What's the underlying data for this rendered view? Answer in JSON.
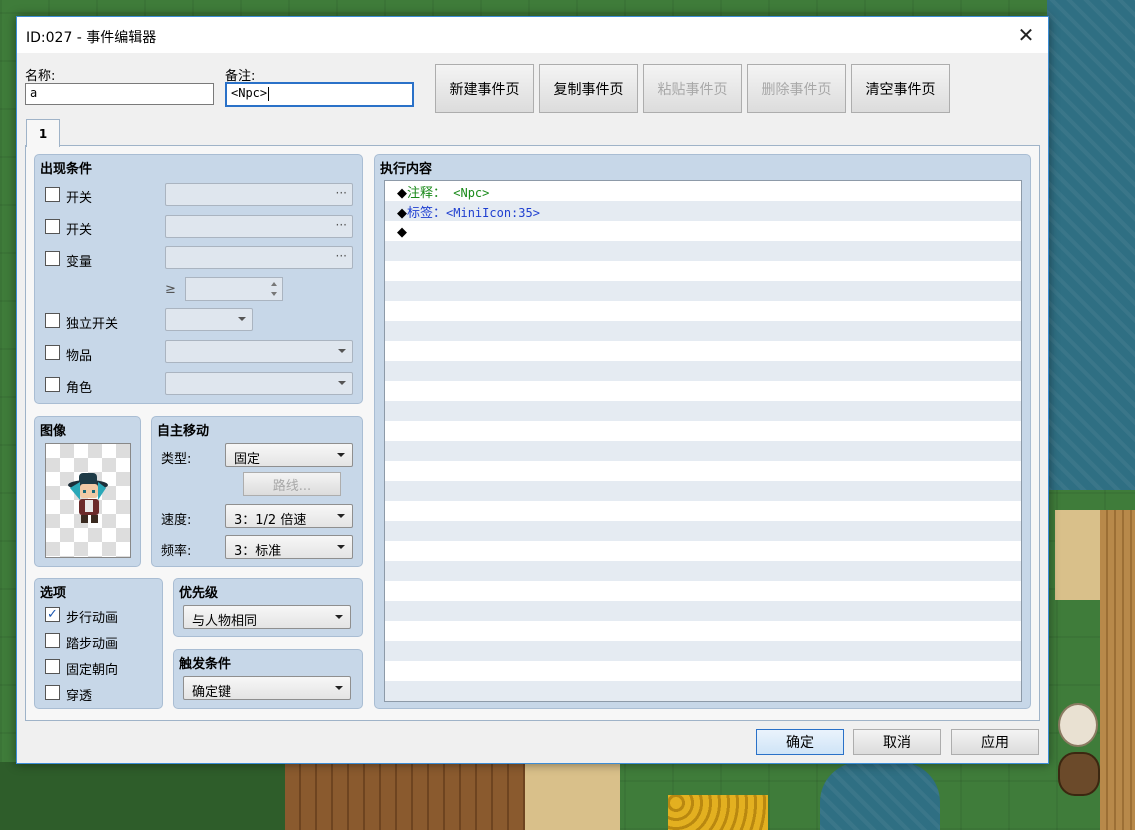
{
  "window": {
    "title": "ID:027 - 事件编辑器",
    "name_label": "名称:",
    "name_value": "a",
    "note_label": "备注:",
    "note_value": "<Npc>",
    "buttons": {
      "new_page": "新建事件页",
      "copy_page": "复制事件页",
      "paste_page": "粘贴事件页",
      "delete_page": "删除事件页",
      "clear_page": "清空事件页"
    },
    "tab_label": "1"
  },
  "conditions": {
    "title": "出现条件",
    "switch1_label": "开关",
    "switch2_label": "开关",
    "variable_label": "变量",
    "ge_symbol": "≥",
    "self_switch_label": "独立开关",
    "item_label": "物品",
    "actor_label": "角色",
    "dots": "···"
  },
  "image": {
    "title": "图像"
  },
  "movement": {
    "title": "自主移动",
    "type_label": "类型:",
    "type_value": "固定",
    "route_button": "路线...",
    "speed_label": "速度:",
    "speed_value": "3：1/2 倍速",
    "freq_label": "频率:",
    "freq_value": "3：标准"
  },
  "options": {
    "title": "选项",
    "walking": "步行动画",
    "walking_checked": true,
    "stepping": "踏步动画",
    "direction_fix": "固定朝向",
    "through": "穿透",
    "check_mark": "✓"
  },
  "priority": {
    "title": "优先级",
    "value": "与人物相同"
  },
  "trigger": {
    "title": "触发条件",
    "value": "确定键"
  },
  "contents": {
    "title": "执行内容",
    "lines": [
      {
        "marker": "◆",
        "cmd": "注释：",
        "value": " <Npc>"
      },
      {
        "marker": "◆",
        "cmd": "标签：",
        "value": "<MiniIcon:35>"
      },
      {
        "marker": "◆",
        "cmd": "",
        "value": ""
      }
    ]
  },
  "footer": {
    "ok": "确定",
    "cancel": "取消",
    "apply": "应用"
  },
  "colors": {
    "accent": "#2a71c8",
    "comment": "#1a8a1a",
    "label": "#1f3fd0",
    "group_bg": "#c7d7e8"
  }
}
